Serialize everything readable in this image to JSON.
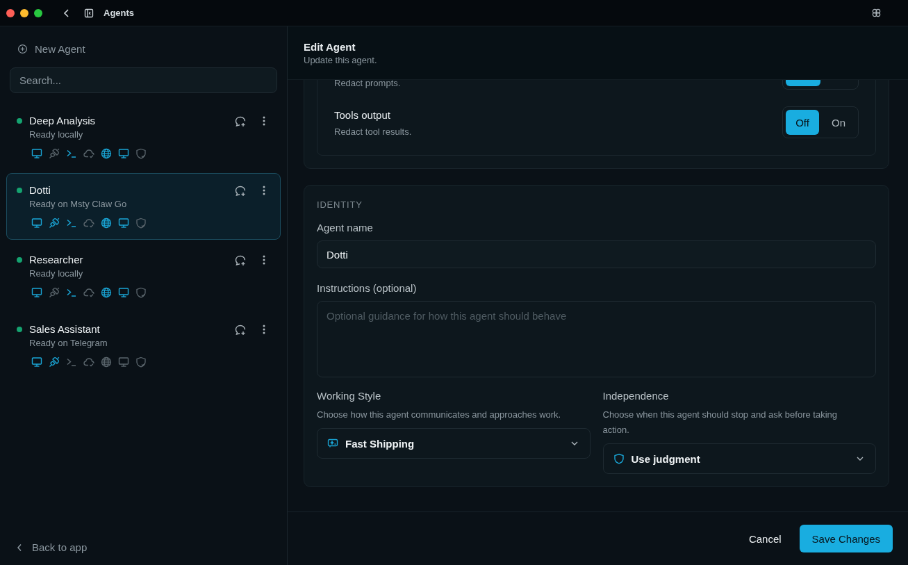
{
  "window": {
    "title": "Agents"
  },
  "sidebar": {
    "new_agent": "New Agent",
    "search": {
      "placeholder": "Search..."
    },
    "agents": [
      {
        "name": "Deep Analysis",
        "status": "Ready locally",
        "selected": false,
        "capabilities": [
          {
            "kind": "monitor",
            "on": true
          },
          {
            "kind": "plug",
            "on": false
          },
          {
            "kind": "terminal",
            "on": true
          },
          {
            "kind": "cloud",
            "on": false
          },
          {
            "kind": "globe",
            "on": true
          },
          {
            "kind": "monitor",
            "on": true
          },
          {
            "kind": "shield",
            "on": false
          }
        ]
      },
      {
        "name": "Dotti",
        "status": "Ready on Msty Claw Go",
        "selected": true,
        "capabilities": [
          {
            "kind": "monitor",
            "on": true
          },
          {
            "kind": "plug",
            "on": true
          },
          {
            "kind": "terminal",
            "on": true
          },
          {
            "kind": "cloud",
            "on": false
          },
          {
            "kind": "globe",
            "on": true
          },
          {
            "kind": "monitor",
            "on": true
          },
          {
            "kind": "shield",
            "on": false
          }
        ]
      },
      {
        "name": "Researcher",
        "status": "Ready locally",
        "selected": false,
        "capabilities": [
          {
            "kind": "monitor",
            "on": true
          },
          {
            "kind": "plug",
            "on": false
          },
          {
            "kind": "terminal",
            "on": true
          },
          {
            "kind": "cloud",
            "on": false
          },
          {
            "kind": "globe",
            "on": true
          },
          {
            "kind": "monitor",
            "on": true
          },
          {
            "kind": "shield",
            "on": false
          }
        ]
      },
      {
        "name": "Sales Assistant",
        "status": "Ready on Telegram",
        "selected": false,
        "capabilities": [
          {
            "kind": "monitor",
            "on": true
          },
          {
            "kind": "plug",
            "on": true
          },
          {
            "kind": "terminal",
            "on": false
          },
          {
            "kind": "cloud",
            "on": false
          },
          {
            "kind": "globe",
            "on": false
          },
          {
            "kind": "monitor",
            "on": false
          },
          {
            "kind": "shield",
            "on": false
          }
        ]
      }
    ],
    "back": "Back to app"
  },
  "editor": {
    "title": "Edit Agent",
    "subtitle": "Update this agent.",
    "privacy_rows": [
      {
        "description": "Redact prompts.",
        "options": [
          {
            "selected": true
          }
        ]
      },
      {
        "title": "Tools output",
        "description": "Redact tool results.",
        "options": [
          {
            "label": "Off",
            "selected": true
          },
          {
            "label": "On",
            "selected": false
          }
        ]
      }
    ],
    "identity": {
      "section_label": "IDENTITY",
      "name_label": "Agent name",
      "name_value": "Dotti",
      "instructions_label": "Instructions (optional)",
      "instructions_placeholder": "Optional guidance for how this agent should behave",
      "working_style": {
        "label": "Working Style",
        "help": "Choose how this agent communicates and approaches work.",
        "value": "Fast Shipping"
      },
      "independence": {
        "label": "Independence",
        "help": "Choose when this agent should stop and ask before taking action.",
        "value": "Use judgment"
      }
    }
  },
  "footer": {
    "cancel": "Cancel",
    "save": "Save Changes"
  }
}
